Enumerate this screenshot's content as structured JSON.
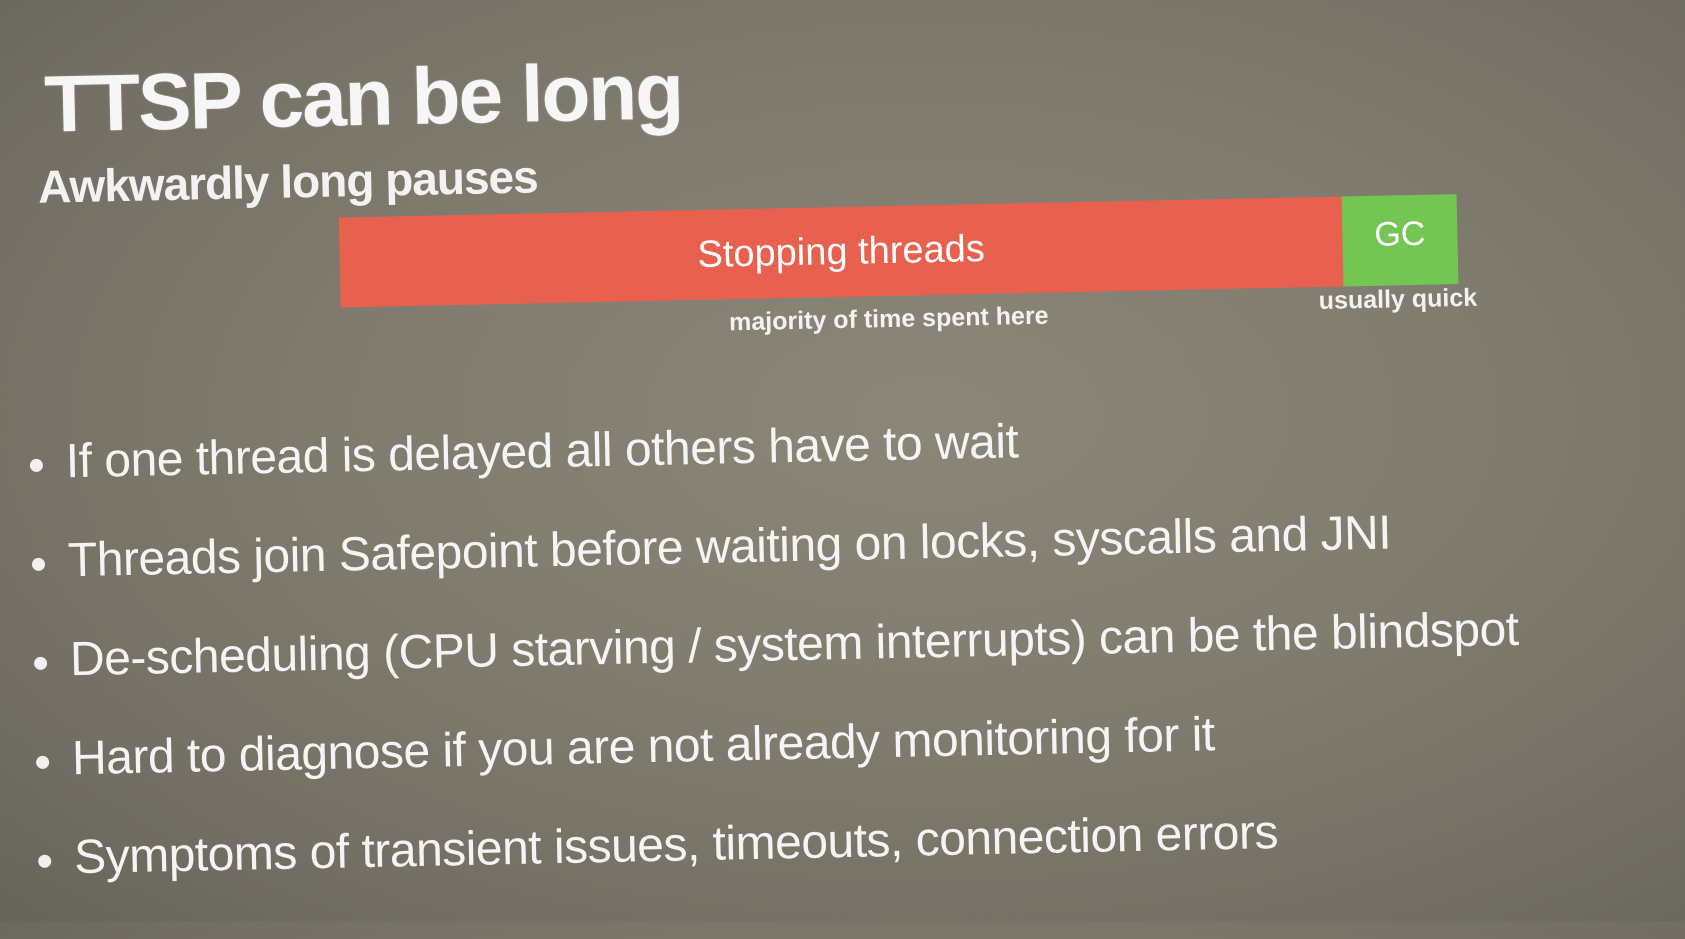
{
  "slide": {
    "title": "TTSP can be long",
    "subtitle": "Awkwardly long pauses"
  },
  "timeline": {
    "segments": [
      {
        "label": "Stopping threads",
        "color": "#e8604e",
        "caption": "majority of time spent here"
      },
      {
        "label": "GC",
        "color": "#74c654",
        "caption": "usually quick"
      }
    ]
  },
  "bullets": [
    "If one thread is delayed all others have to wait",
    "Threads join Safepoint before waiting on locks, syscalls and JNI",
    "De-scheduling (CPU starving / system interrupts) can be the blindspot",
    "Hard to diagnose if you are not already monitoring for it",
    "Symptoms of transient issues, timeouts, connection errors"
  ]
}
